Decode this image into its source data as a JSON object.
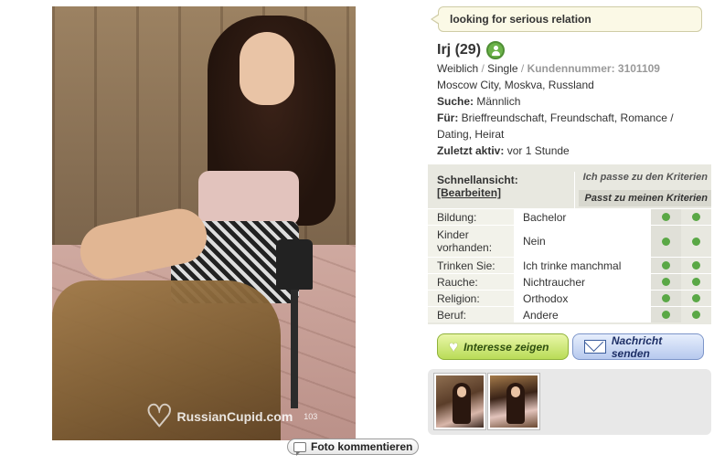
{
  "status_message": "looking for serious relation",
  "profile": {
    "name_age": "Irj (29)",
    "gender": "Weiblich",
    "sep1": "/",
    "relationship": "Single",
    "sep2": "/",
    "customer_number_label": "Kundennummer:",
    "customer_number": "3101109",
    "location": "Moscow City, Moskva, Russland",
    "search_label": "Suche:",
    "search_value": "Männlich",
    "for_label": "Für:",
    "for_value_line1": "Brieffreundschaft, Freundschaft, Romance /",
    "for_value_line2": "Dating, Heirat",
    "last_active_label": "Zuletzt aktiv:",
    "last_active_value": "vor 1 Stunde"
  },
  "quick_view": {
    "title": "Schnellansicht:",
    "edit_link": "[Bearbeiten]",
    "criteria_1": "Ich passe zu den Kriterien",
    "criteria_2": "Passt zu meinen Kriterien",
    "rows": [
      {
        "label": "Bildung:",
        "value": "Bachelor"
      },
      {
        "label": "Kinder vorhanden:",
        "value": "Nein"
      },
      {
        "label": "Trinken Sie:",
        "value": "Ich trinke manchmal"
      },
      {
        "label": "Rauche:",
        "value": "Nichtraucher"
      },
      {
        "label": "Religion:",
        "value": "Orthodox"
      },
      {
        "label": "Beruf:",
        "value": "Andere"
      }
    ]
  },
  "actions": {
    "interest_label": "Interesse zeigen",
    "message_label": "Nachricht senden"
  },
  "photo": {
    "watermark_brand": "RussianCupid.com",
    "watermark_num": "103",
    "comment_label": "Foto kommentieren"
  },
  "colors": {
    "match_dot": "#5aa846",
    "interest_button": "#b9dc57",
    "message_button": "#b7c9ee",
    "quick_view_bg": "#e8e8e0"
  },
  "icons": {
    "online": "online-user-icon",
    "heart": "heart-icon",
    "mail": "mail-icon",
    "comment": "comment-icon"
  }
}
